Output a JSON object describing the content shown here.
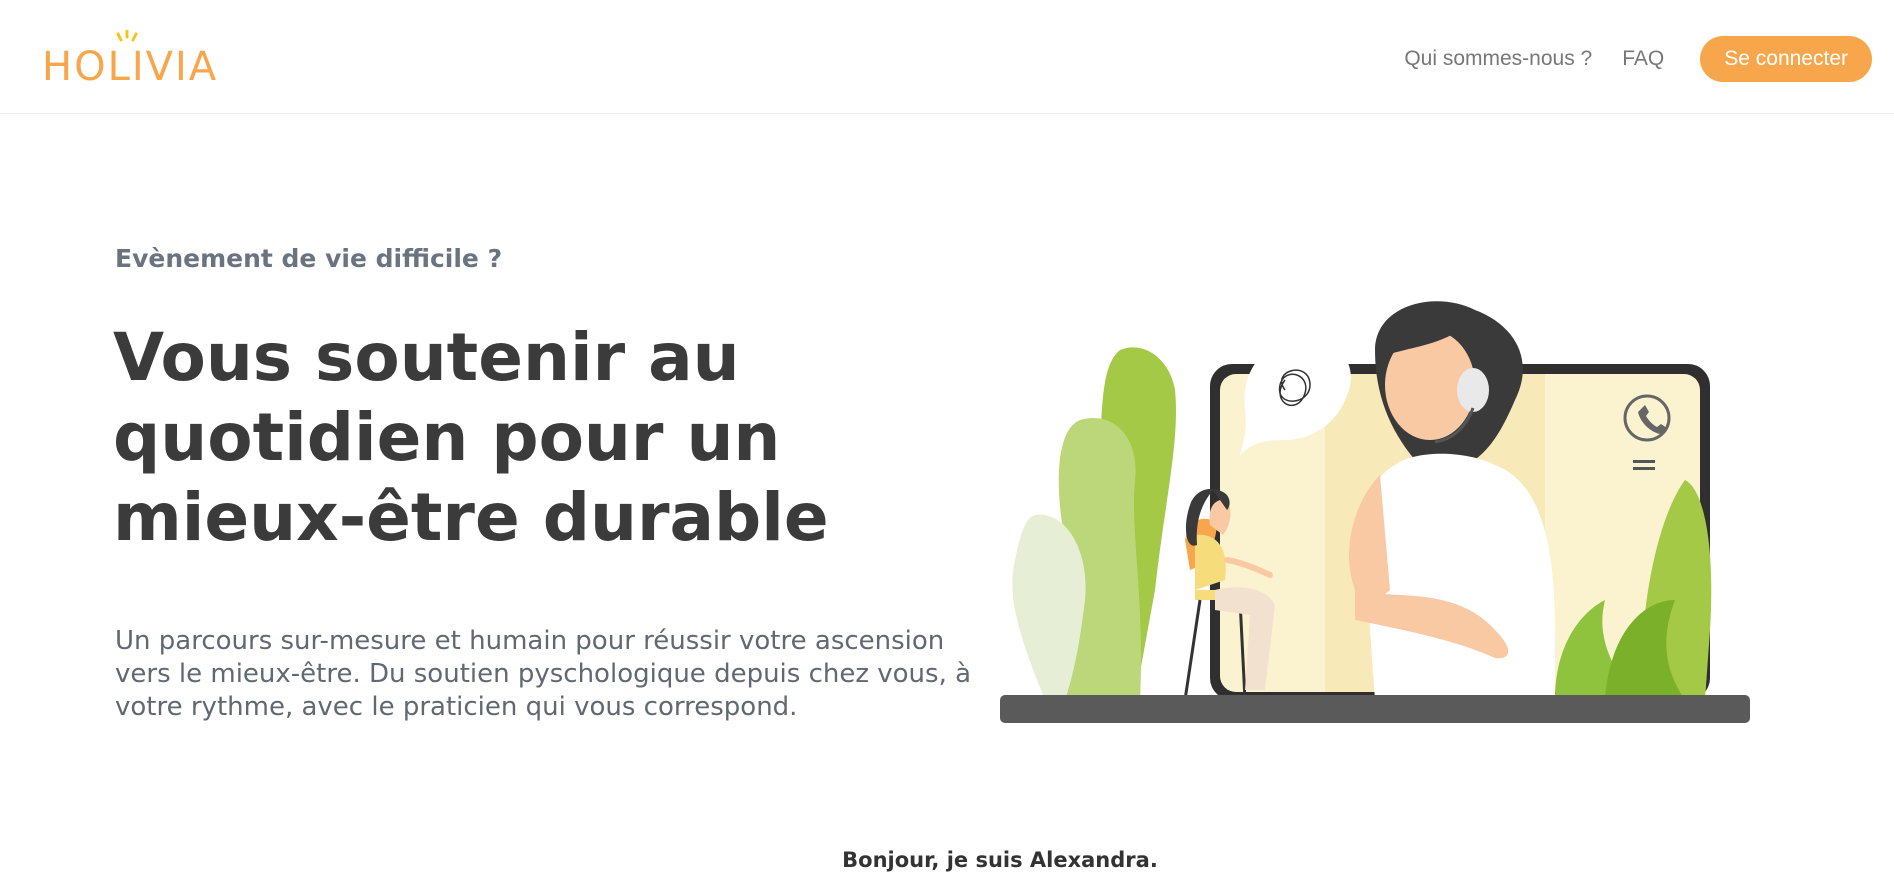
{
  "header": {
    "logo_text": "HOLIVIA",
    "nav": {
      "about_label": "Qui sommes-nous ?",
      "faq_label": "FAQ",
      "login_label": "Se connecter"
    }
  },
  "hero": {
    "eyebrow": "Evènement de vie difficile ?",
    "title": "Vous soutenir au quotidien pour un mieux-être durable",
    "description": "Un parcours sur-mesure et humain pour réussir votre ascension vers le mieux-être. Du soutien pyschologique depuis chez vous, à votre rythme, avec le praticien qui vous correspond."
  },
  "intro": {
    "greeting": "Bonjour, je suis Alexandra."
  },
  "colors": {
    "brand_orange": "#f8a64c",
    "leaf_green": "#8fc23d",
    "text_dark": "#3b3b3b",
    "text_gray": "#697480"
  }
}
